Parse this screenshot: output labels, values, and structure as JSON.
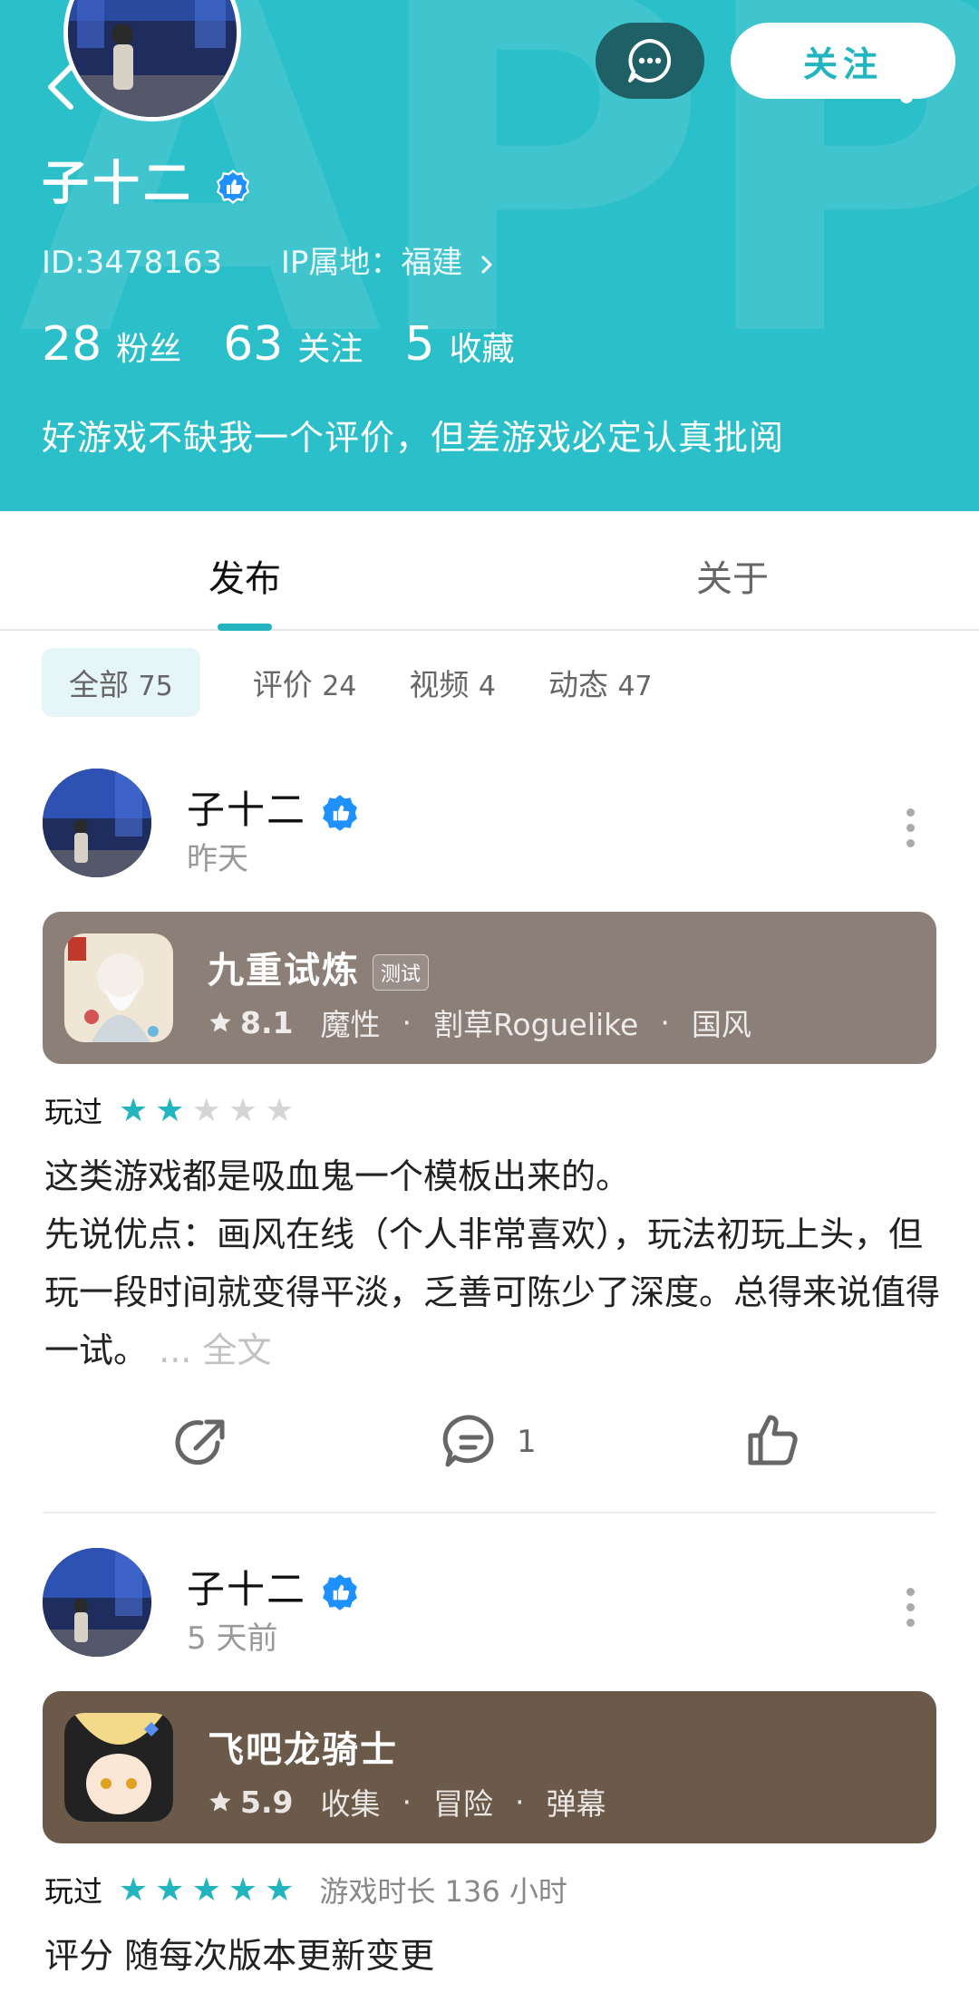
{
  "header": {
    "watermark": "APP",
    "username": "子十二",
    "id_text": "ID:3478163",
    "ip_text": "IP属地：福建",
    "follow_label": "关注",
    "stats": [
      {
        "num": "28",
        "label": "粉丝"
      },
      {
        "num": "63",
        "label": "关注"
      },
      {
        "num": "5",
        "label": "收藏"
      }
    ],
    "bio": "好游戏不缺我一个评价，但差游戏必定认真批阅"
  },
  "tabs": {
    "active": "发布",
    "other": "关于"
  },
  "filters": [
    {
      "label": "全部",
      "count": "75"
    },
    {
      "label": "评价",
      "count": "24"
    },
    {
      "label": "视频",
      "count": "4"
    },
    {
      "label": "动态",
      "count": "47"
    }
  ],
  "posts": [
    {
      "author": "子十二",
      "time": "昨天",
      "game": {
        "title": "九重试炼",
        "tag": "测试",
        "score": "8.1",
        "tags": [
          "魔性",
          "割草Roguelike",
          "国风"
        ],
        "card_color": "#8b7f78"
      },
      "played_label": "玩过",
      "stars": 2,
      "content": [
        "这类游戏都是吸血鬼一个模板出来的。",
        "先说优点：画风在线（个人非常喜欢），玩法初玩上头，但玩一段时间就变得平淡，乏善可陈少了深度。总得来说值得一试。"
      ],
      "more_label": "... 全文",
      "comments": "1"
    },
    {
      "author": "子十二",
      "time": "5 天前",
      "game": {
        "title": "飞吧龙骑士",
        "score": "5.9",
        "tags": [
          "收集",
          "冒险",
          "弹幕"
        ],
        "card_color": "#6b5a4a"
      },
      "played_label": "玩过",
      "stars": 5,
      "play_time": "游戏时长 136 小时",
      "content": [
        "评分 随每次版本更新变更"
      ]
    }
  ]
}
